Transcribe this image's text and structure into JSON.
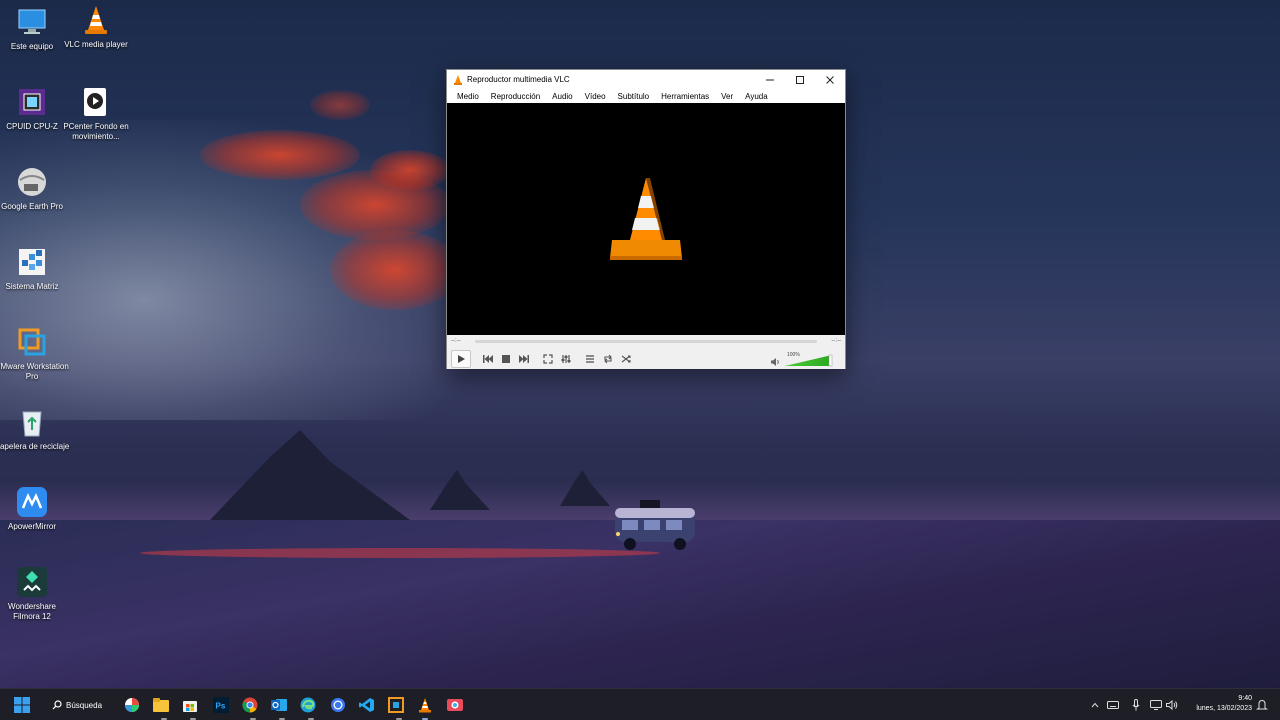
{
  "desktop": {
    "icons": [
      {
        "label": "Este equipo",
        "icon": "computer-icon"
      },
      {
        "label": "VLC media player",
        "icon": "vlc-icon"
      },
      {
        "label": "CPUID CPU-Z",
        "icon": "cpuz-icon"
      },
      {
        "label": "PCenter Fondo en movimiento...",
        "icon": "pcenter-icon"
      },
      {
        "label": "Google Earth Pro",
        "icon": "google-earth-icon"
      },
      {
        "label": "Sistema Matriz",
        "icon": "sistema-matriz-icon"
      },
      {
        "label": "VMware Workstation Pro",
        "icon": "vmware-icon"
      },
      {
        "label": "Papelera de reciclaje",
        "icon": "recycle-bin-icon"
      },
      {
        "label": "ApowerMirror",
        "icon": "apowermirror-icon"
      },
      {
        "label": "Wondershare Filmora 12",
        "icon": "filmora-icon"
      }
    ]
  },
  "vlc": {
    "title": "Reproductor multimedia VLC",
    "menu": [
      "Medio",
      "Reproducción",
      "Audio",
      "Vídeo",
      "Subtítulo",
      "Herramientas",
      "Ver",
      "Ayuda"
    ],
    "time_elapsed": "--:--",
    "time_total": "--:--",
    "volume_label": "100%",
    "volume_level": 1.0,
    "accent": "#ff8800"
  },
  "taskbar": {
    "search_label": "Búsqueda",
    "pinned": [
      "start-icon",
      "search-icon",
      "chrome-alt-icon",
      "file-explorer-icon",
      "store-icon",
      "photoshop-icon",
      "chrome-icon",
      "outlook-icon",
      "edge-icon",
      "signal-icon",
      "vscode-icon",
      "sistema-icon",
      "vlc-icon",
      "snagit-icon"
    ],
    "time": "9:40",
    "date": "lunes, 13/02/2023"
  }
}
